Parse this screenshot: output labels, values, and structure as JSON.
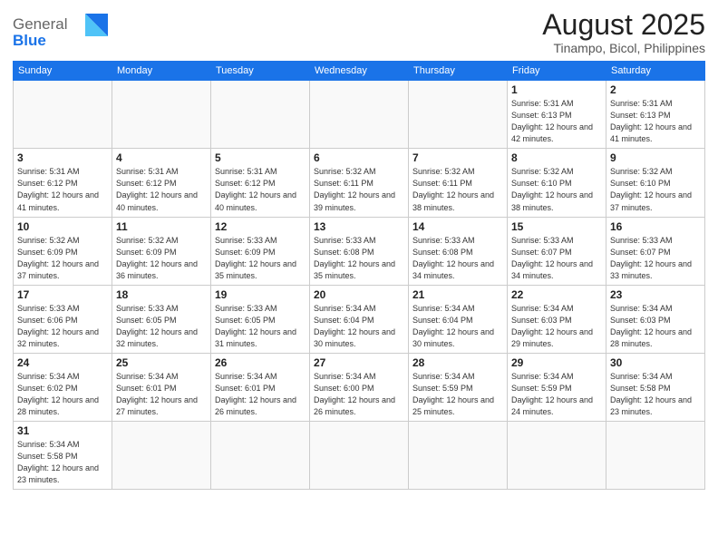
{
  "logo": {
    "text_general": "General",
    "text_blue": "Blue"
  },
  "header": {
    "month_year": "August 2025",
    "location": "Tinampo, Bicol, Philippines"
  },
  "weekdays": [
    "Sunday",
    "Monday",
    "Tuesday",
    "Wednesday",
    "Thursday",
    "Friday",
    "Saturday"
  ],
  "weeks": [
    [
      {
        "day": null,
        "info": null
      },
      {
        "day": null,
        "info": null
      },
      {
        "day": null,
        "info": null
      },
      {
        "day": null,
        "info": null
      },
      {
        "day": null,
        "info": null
      },
      {
        "day": "1",
        "info": "Sunrise: 5:31 AM\nSunset: 6:13 PM\nDaylight: 12 hours\nand 42 minutes."
      },
      {
        "day": "2",
        "info": "Sunrise: 5:31 AM\nSunset: 6:13 PM\nDaylight: 12 hours\nand 41 minutes."
      }
    ],
    [
      {
        "day": "3",
        "info": "Sunrise: 5:31 AM\nSunset: 6:12 PM\nDaylight: 12 hours\nand 41 minutes."
      },
      {
        "day": "4",
        "info": "Sunrise: 5:31 AM\nSunset: 6:12 PM\nDaylight: 12 hours\nand 40 minutes."
      },
      {
        "day": "5",
        "info": "Sunrise: 5:31 AM\nSunset: 6:12 PM\nDaylight: 12 hours\nand 40 minutes."
      },
      {
        "day": "6",
        "info": "Sunrise: 5:32 AM\nSunset: 6:11 PM\nDaylight: 12 hours\nand 39 minutes."
      },
      {
        "day": "7",
        "info": "Sunrise: 5:32 AM\nSunset: 6:11 PM\nDaylight: 12 hours\nand 38 minutes."
      },
      {
        "day": "8",
        "info": "Sunrise: 5:32 AM\nSunset: 6:10 PM\nDaylight: 12 hours\nand 38 minutes."
      },
      {
        "day": "9",
        "info": "Sunrise: 5:32 AM\nSunset: 6:10 PM\nDaylight: 12 hours\nand 37 minutes."
      }
    ],
    [
      {
        "day": "10",
        "info": "Sunrise: 5:32 AM\nSunset: 6:09 PM\nDaylight: 12 hours\nand 37 minutes."
      },
      {
        "day": "11",
        "info": "Sunrise: 5:32 AM\nSunset: 6:09 PM\nDaylight: 12 hours\nand 36 minutes."
      },
      {
        "day": "12",
        "info": "Sunrise: 5:33 AM\nSunset: 6:09 PM\nDaylight: 12 hours\nand 35 minutes."
      },
      {
        "day": "13",
        "info": "Sunrise: 5:33 AM\nSunset: 6:08 PM\nDaylight: 12 hours\nand 35 minutes."
      },
      {
        "day": "14",
        "info": "Sunrise: 5:33 AM\nSunset: 6:08 PM\nDaylight: 12 hours\nand 34 minutes."
      },
      {
        "day": "15",
        "info": "Sunrise: 5:33 AM\nSunset: 6:07 PM\nDaylight: 12 hours\nand 34 minutes."
      },
      {
        "day": "16",
        "info": "Sunrise: 5:33 AM\nSunset: 6:07 PM\nDaylight: 12 hours\nand 33 minutes."
      }
    ],
    [
      {
        "day": "17",
        "info": "Sunrise: 5:33 AM\nSunset: 6:06 PM\nDaylight: 12 hours\nand 32 minutes."
      },
      {
        "day": "18",
        "info": "Sunrise: 5:33 AM\nSunset: 6:05 PM\nDaylight: 12 hours\nand 32 minutes."
      },
      {
        "day": "19",
        "info": "Sunrise: 5:33 AM\nSunset: 6:05 PM\nDaylight: 12 hours\nand 31 minutes."
      },
      {
        "day": "20",
        "info": "Sunrise: 5:34 AM\nSunset: 6:04 PM\nDaylight: 12 hours\nand 30 minutes."
      },
      {
        "day": "21",
        "info": "Sunrise: 5:34 AM\nSunset: 6:04 PM\nDaylight: 12 hours\nand 30 minutes."
      },
      {
        "day": "22",
        "info": "Sunrise: 5:34 AM\nSunset: 6:03 PM\nDaylight: 12 hours\nand 29 minutes."
      },
      {
        "day": "23",
        "info": "Sunrise: 5:34 AM\nSunset: 6:03 PM\nDaylight: 12 hours\nand 28 minutes."
      }
    ],
    [
      {
        "day": "24",
        "info": "Sunrise: 5:34 AM\nSunset: 6:02 PM\nDaylight: 12 hours\nand 28 minutes."
      },
      {
        "day": "25",
        "info": "Sunrise: 5:34 AM\nSunset: 6:01 PM\nDaylight: 12 hours\nand 27 minutes."
      },
      {
        "day": "26",
        "info": "Sunrise: 5:34 AM\nSunset: 6:01 PM\nDaylight: 12 hours\nand 26 minutes."
      },
      {
        "day": "27",
        "info": "Sunrise: 5:34 AM\nSunset: 6:00 PM\nDaylight: 12 hours\nand 26 minutes."
      },
      {
        "day": "28",
        "info": "Sunrise: 5:34 AM\nSunset: 5:59 PM\nDaylight: 12 hours\nand 25 minutes."
      },
      {
        "day": "29",
        "info": "Sunrise: 5:34 AM\nSunset: 5:59 PM\nDaylight: 12 hours\nand 24 minutes."
      },
      {
        "day": "30",
        "info": "Sunrise: 5:34 AM\nSunset: 5:58 PM\nDaylight: 12 hours\nand 23 minutes."
      }
    ],
    [
      {
        "day": "31",
        "info": "Sunrise: 5:34 AM\nSunset: 5:58 PM\nDaylight: 12 hours\nand 23 minutes."
      },
      {
        "day": null,
        "info": null
      },
      {
        "day": null,
        "info": null
      },
      {
        "day": null,
        "info": null
      },
      {
        "day": null,
        "info": null
      },
      {
        "day": null,
        "info": null
      },
      {
        "day": null,
        "info": null
      }
    ]
  ]
}
